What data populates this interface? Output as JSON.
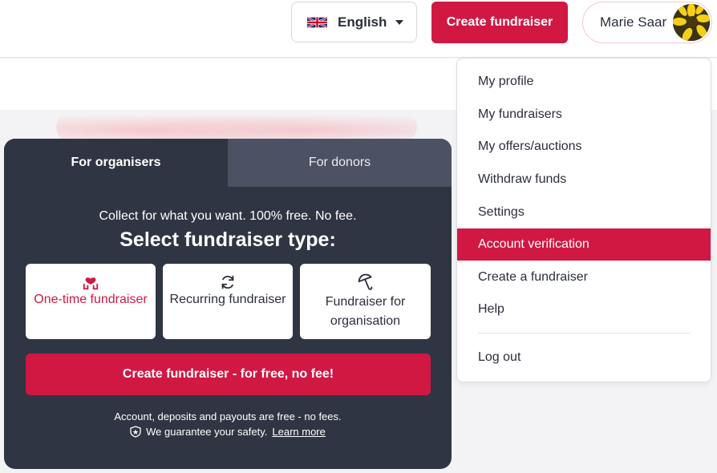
{
  "header": {
    "language_label": "English",
    "create_label": "Create fundraiser",
    "user_name": "Marie Saar"
  },
  "card": {
    "tabs": [
      "For organisers",
      "For donors"
    ],
    "collect_text": "Collect for what you want. 100% free. No fee.",
    "select_title": "Select fundraiser type:",
    "types": [
      {
        "label": "One-time fundraiser",
        "icon": "hands-heart-icon"
      },
      {
        "label": "Recurring fundraiser",
        "icon": "refresh-icon"
      },
      {
        "label": "Fundraiser for organisation",
        "icon": "umbrella-icon"
      }
    ],
    "cta_label": "Create fundraiser - for free, no fee!",
    "footer_line1": "Account, deposits and payouts are free - no fees.",
    "footer_line2": "We guarantee your safety.",
    "learn_more": "Learn more"
  },
  "menu": {
    "items": [
      "My profile",
      "My fundraisers",
      "My offers/auctions",
      "Withdraw funds",
      "Settings",
      "Account verification",
      "Create a fundraiser",
      "Help",
      "Log out"
    ],
    "active": "Account verification"
  },
  "colors": {
    "brand": "#d01843",
    "card_bg": "#303543",
    "tab_inactive": "#4c5263"
  }
}
